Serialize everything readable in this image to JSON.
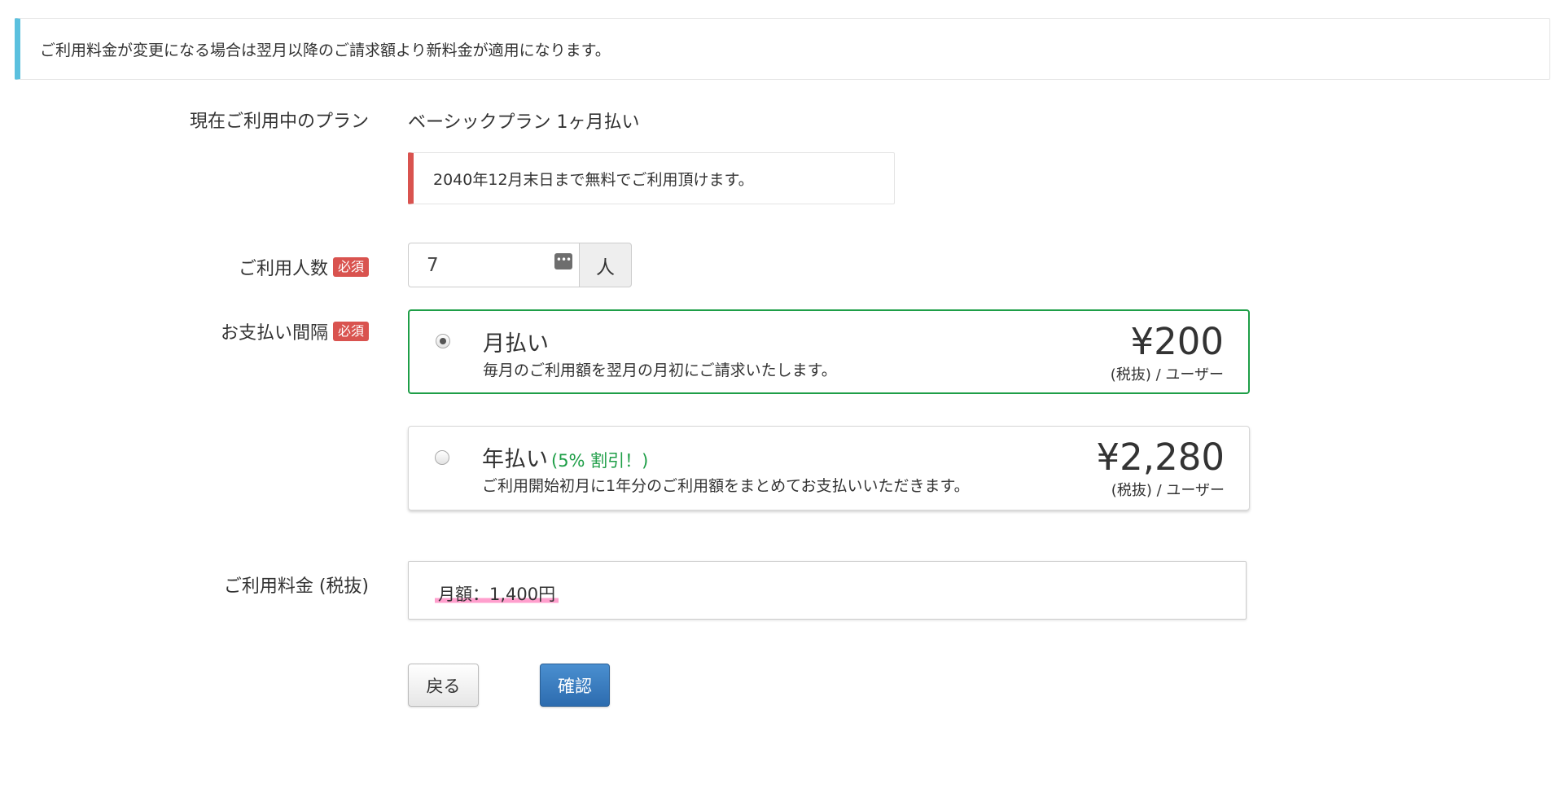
{
  "notice_top": "ご利用料金が変更になる場合は翌月以降のご請求額より新料金が適用になります。",
  "current_plan": {
    "label": "現在ご利用中のプラン",
    "value": "ベーシックプラン 1ヶ月払い",
    "free_notice": "2040年12月末日まで無料でご利用頂けます。"
  },
  "users": {
    "label": "ご利用人数",
    "required_badge": "必須",
    "value": "7",
    "unit": "人"
  },
  "payment_interval": {
    "label": "お支払い間隔",
    "required_badge": "必須",
    "options": [
      {
        "title": "月払い",
        "discount": "",
        "description": "毎月のご利用額を翌月の月初にご請求いたします。",
        "price": "¥200",
        "unit": "(税抜) / ユーザー",
        "selected": true
      },
      {
        "title": "年払い",
        "discount": "(5% 割引！)",
        "description": "ご利用開始初月に1年分のご利用額をまとめてお支払いいただきます。",
        "price": "¥2,280",
        "unit": "(税抜) / ユーザー",
        "selected": false
      }
    ]
  },
  "fee": {
    "label": "ご利用料金 (税抜)",
    "value": "月額：1,400円"
  },
  "buttons": {
    "back": "戻る",
    "confirm": "確認"
  },
  "colors": {
    "info_accent": "#5bc0de",
    "danger_accent": "#d9534f",
    "selected_border": "#1e9e47",
    "primary_button": "#337ab7",
    "highlight": "#ff9fcd"
  }
}
